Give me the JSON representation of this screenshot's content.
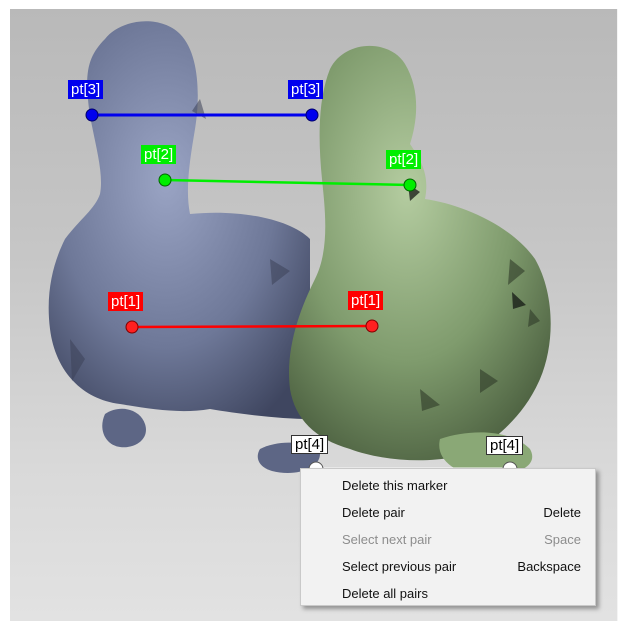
{
  "colors": {
    "marker_pt1": "#ff0000",
    "marker_pt2": "#00ee00",
    "marker_pt3": "#0000ee",
    "marker_pt4": "#ffffff",
    "model_left": "#6f7a9c",
    "model_right": "#7d9a6a"
  },
  "markers": {
    "pt1_left": "pt[1]",
    "pt1_right": "pt[1]",
    "pt2_left": "pt[2]",
    "pt2_right": "pt[2]",
    "pt3_left": "pt[3]",
    "pt3_right": "pt[3]",
    "pt4_left": "pt[4]",
    "pt4_right": "pt[4]"
  },
  "context_menu": {
    "items": [
      {
        "label": "Delete this marker",
        "shortcut": "",
        "enabled": true
      },
      {
        "label": "Delete pair",
        "shortcut": "Delete",
        "enabled": true
      },
      {
        "label": "Select next pair",
        "shortcut": "Space",
        "enabled": false
      },
      {
        "label": "Select previous pair",
        "shortcut": "Backspace",
        "enabled": true
      },
      {
        "label": "Delete all pairs",
        "shortcut": "",
        "enabled": true
      }
    ]
  }
}
